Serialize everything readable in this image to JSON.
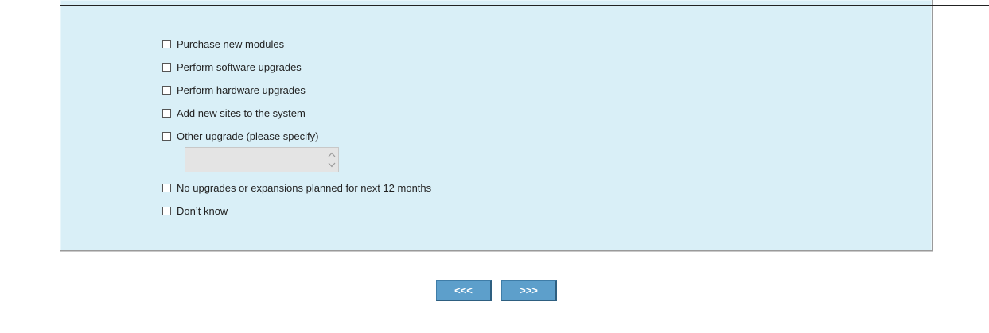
{
  "question": {
    "options": [
      {
        "label": "Purchase new modules",
        "checked": false
      },
      {
        "label": "Perform software upgrades",
        "checked": false
      },
      {
        "label": "Perform hardware upgrades",
        "checked": false
      },
      {
        "label": "Add new sites to the system",
        "checked": false
      },
      {
        "label": "Other upgrade (please specify)",
        "checked": false
      },
      {
        "label": "No upgrades or expansions planned for next 12 months",
        "checked": false
      },
      {
        "label": "Don’t know",
        "checked": false
      }
    ],
    "other_value": ""
  },
  "nav": {
    "back_label": "<<<",
    "next_label": ">>>"
  },
  "icons": {
    "spin_up": "chevron-up-icon",
    "spin_down": "chevron-down-icon"
  },
  "colors": {
    "panel_bg": "#d9eff7",
    "button_bg": "#5d9fcb"
  }
}
